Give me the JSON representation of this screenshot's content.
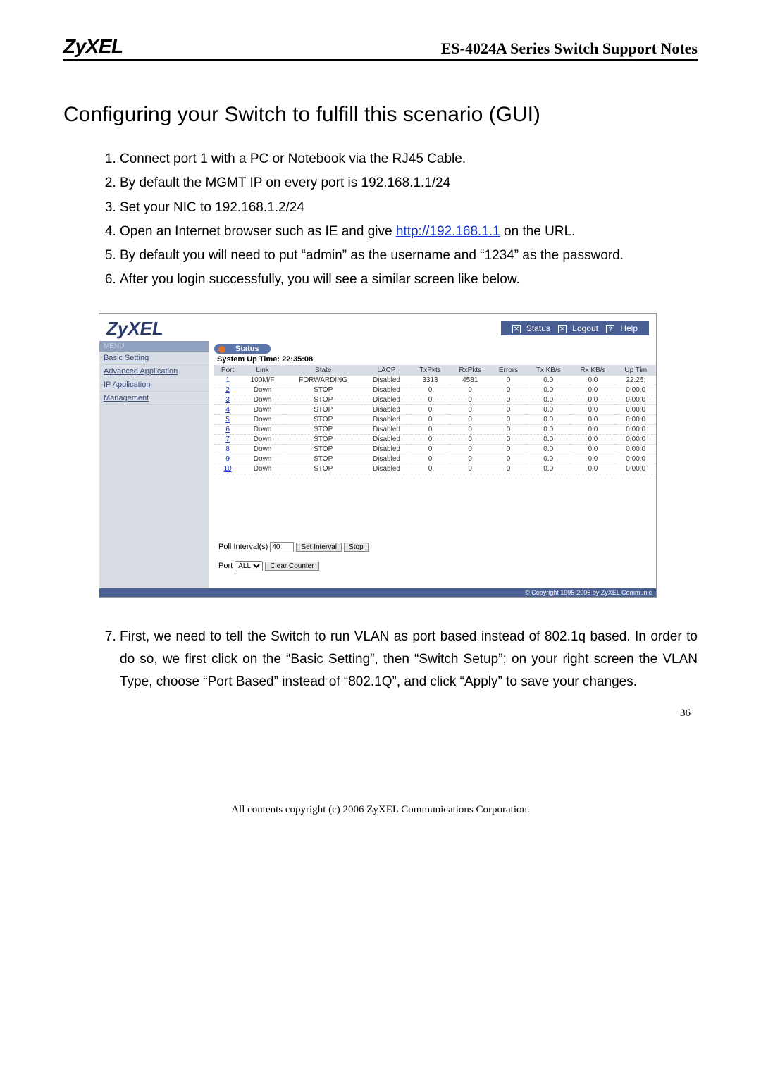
{
  "header": {
    "logo": "ZyXEL",
    "title": "ES-4024A Series Switch Support Notes"
  },
  "section_title": "Configuring your Switch to fulfill this scenario (GUI)",
  "steps": {
    "s1": "Connect port 1 with a PC or Notebook via the RJ45 Cable.",
    "s2": "By default the MGMT IP on every port is 192.168.1.1/24",
    "s3": "Set your NIC to 192.168.1.2/24",
    "s4_pre": "Open an Internet browser such as IE and give ",
    "s4_link": "http://192.168.1.1",
    "s4_post": " on the URL.",
    "s5": "By default you will need to put “admin” as the username and “1234” as the password.",
    "s6": "After you login successfully, you will see a similar screen like below.",
    "s7": "First, we need to tell the Switch to run VLAN as port based instead of 802.1q based. In order to do so, we first click on the “Basic Setting”, then “Switch Setup”; on your right screen the VLAN Type, choose “Port Based” instead of “802.1Q”, and click “Apply” to save your changes."
  },
  "screenshot": {
    "logo": "ZyXEL",
    "top_links": {
      "status": "Status",
      "logout": "Logout",
      "help": "Help"
    },
    "menu_title": "MENU",
    "menu": [
      "Basic Setting",
      "Advanced Application",
      "IP Application",
      "Management"
    ],
    "status_label": "Status",
    "uptime": "System Up Time: 22:35:08",
    "columns": [
      "Port",
      "Link",
      "State",
      "LACP",
      "TxPkts",
      "RxPkts",
      "Errors",
      "Tx KB/s",
      "Rx KB/s",
      "Up Tim"
    ],
    "rows": [
      {
        "port": "1",
        "link": "100M/F",
        "state": "FORWARDING",
        "lacp": "Disabled",
        "tx": "3313",
        "rx": "4581",
        "err": "0",
        "txk": "0.0",
        "rxk": "0.0",
        "up": "22:25:"
      },
      {
        "port": "2",
        "link": "Down",
        "state": "STOP",
        "lacp": "Disabled",
        "tx": "0",
        "rx": "0",
        "err": "0",
        "txk": "0.0",
        "rxk": "0.0",
        "up": "0:00:0"
      },
      {
        "port": "3",
        "link": "Down",
        "state": "STOP",
        "lacp": "Disabled",
        "tx": "0",
        "rx": "0",
        "err": "0",
        "txk": "0.0",
        "rxk": "0.0",
        "up": "0:00:0"
      },
      {
        "port": "4",
        "link": "Down",
        "state": "STOP",
        "lacp": "Disabled",
        "tx": "0",
        "rx": "0",
        "err": "0",
        "txk": "0.0",
        "rxk": "0.0",
        "up": "0:00:0"
      },
      {
        "port": "5",
        "link": "Down",
        "state": "STOP",
        "lacp": "Disabled",
        "tx": "0",
        "rx": "0",
        "err": "0",
        "txk": "0.0",
        "rxk": "0.0",
        "up": "0:00:0"
      },
      {
        "port": "6",
        "link": "Down",
        "state": "STOP",
        "lacp": "Disabled",
        "tx": "0",
        "rx": "0",
        "err": "0",
        "txk": "0.0",
        "rxk": "0.0",
        "up": "0:00:0"
      },
      {
        "port": "7",
        "link": "Down",
        "state": "STOP",
        "lacp": "Disabled",
        "tx": "0",
        "rx": "0",
        "err": "0",
        "txk": "0.0",
        "rxk": "0.0",
        "up": "0:00:0"
      },
      {
        "port": "8",
        "link": "Down",
        "state": "STOP",
        "lacp": "Disabled",
        "tx": "0",
        "rx": "0",
        "err": "0",
        "txk": "0.0",
        "rxk": "0.0",
        "up": "0:00:0"
      },
      {
        "port": "9",
        "link": "Down",
        "state": "STOP",
        "lacp": "Disabled",
        "tx": "0",
        "rx": "0",
        "err": "0",
        "txk": "0.0",
        "rxk": "0.0",
        "up": "0:00:0"
      },
      {
        "port": "10",
        "link": "Down",
        "state": "STOP",
        "lacp": "Disabled",
        "tx": "0",
        "rx": "0",
        "err": "0",
        "txk": "0.0",
        "rxk": "0.0",
        "up": "0:00:0"
      }
    ],
    "poll": {
      "label": "Poll Interval(s)",
      "value": "40",
      "set_btn": "Set Interval",
      "stop_btn": "Stop",
      "port_label": "Port",
      "port_value": "ALL",
      "clear_btn": "Clear Counter"
    },
    "copyright": "© Copyright 1995-2006 by ZyXEL Communic"
  },
  "footer": {
    "page_num": "36",
    "copyright": "All contents copyright (c) 2006 ZyXEL Communications Corporation."
  }
}
